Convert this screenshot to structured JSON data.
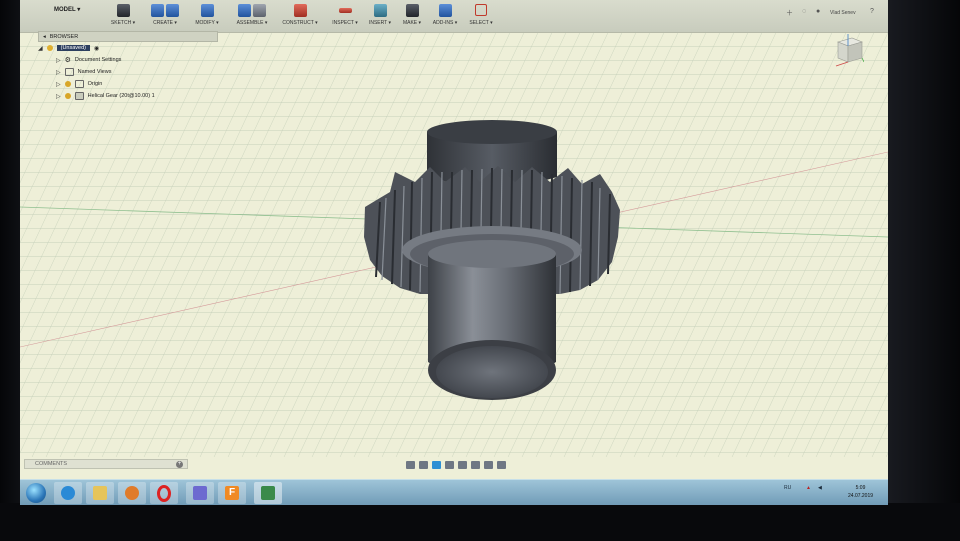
{
  "window": {
    "title": "Untitled(1)",
    "workspace": "MODEL ▾",
    "user": "Vlad Senev"
  },
  "toolbar": {
    "groups": [
      {
        "label": "SKETCH ▾"
      },
      {
        "label": "CREATE ▾"
      },
      {
        "label": "MODIFY ▾"
      },
      {
        "label": "ASSEMBLE ▾"
      },
      {
        "label": "CONSTRUCT ▾"
      },
      {
        "label": "INSPECT ▾"
      },
      {
        "label": "INSERT ▾"
      },
      {
        "label": "MAKE ▾"
      },
      {
        "label": "ADD-INS ▾"
      },
      {
        "label": "SELECT ▾"
      }
    ]
  },
  "browser": {
    "title": "BROWSER",
    "root": "(Unsaved)",
    "items": [
      {
        "label": "Document Settings",
        "icon": "gear-icon"
      },
      {
        "label": "Named Views",
        "icon": "folder-icon"
      },
      {
        "label": "Origin",
        "icon": "folder-icon"
      },
      {
        "label": "Helical Gear (20t@10.00) 1",
        "icon": "component-icon"
      }
    ]
  },
  "comments": {
    "label": "COMMENTS"
  },
  "taskbar": {
    "tray_lang": "RU",
    "time": "5:09",
    "date": "24.07.2019"
  },
  "colors": {
    "viewport_bg": "#eeefd8",
    "grid": "#b9c6ad",
    "gear": "#5b6068",
    "root_highlight": "#2d3f5f",
    "taskbar": "#8db3c9",
    "nav_active": "#2d8fd4"
  }
}
